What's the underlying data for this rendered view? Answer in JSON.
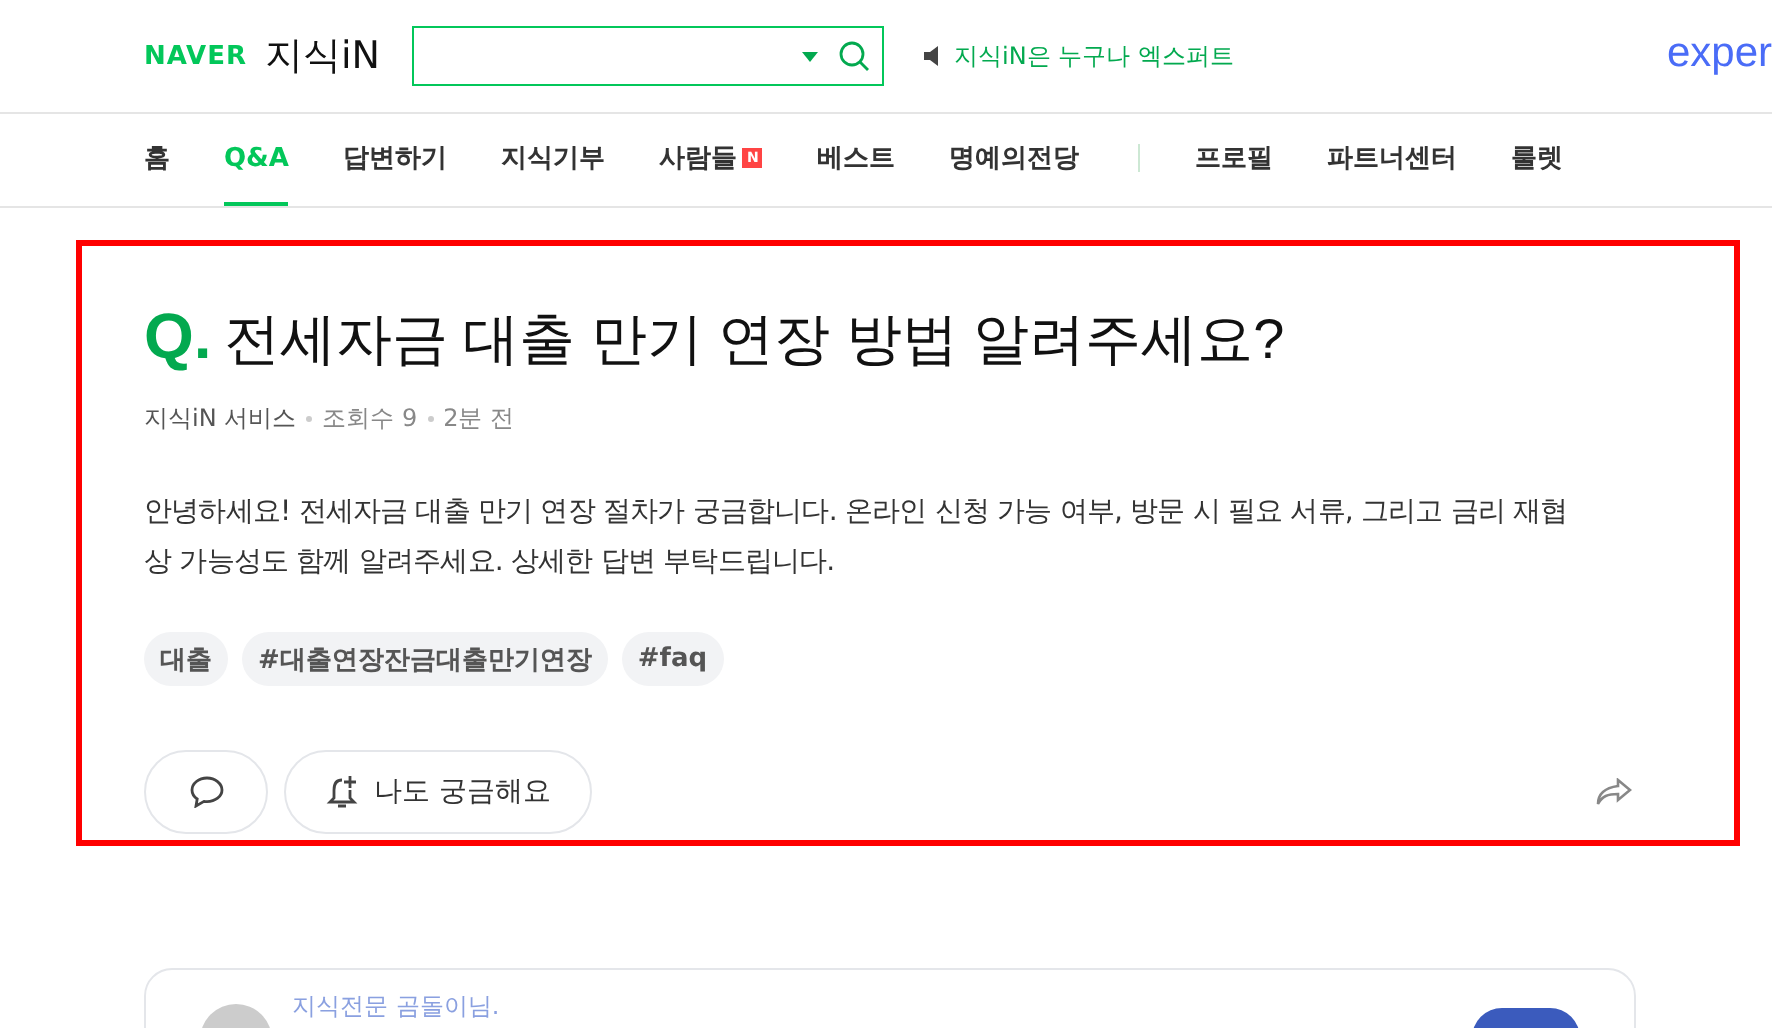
{
  "header": {
    "logo": "NAVER",
    "service": "지식iN",
    "notice": "지식iN은 누구나 엑스퍼트",
    "expert_logo": "exper"
  },
  "nav": [
    {
      "label": "홈",
      "selected": false,
      "new": false
    },
    {
      "label": "Q&A",
      "selected": true,
      "new": false
    },
    {
      "label": "답변하기",
      "selected": false,
      "new": false
    },
    {
      "label": "지식기부",
      "selected": false,
      "new": false
    },
    {
      "label": "사람들",
      "selected": false,
      "new": true,
      "badge": "N"
    },
    {
      "label": "베스트",
      "selected": false,
      "new": false
    },
    {
      "label": "명예의전당",
      "selected": false,
      "new": false,
      "divider_after": true
    },
    {
      "label": "프로필",
      "selected": false,
      "new": false
    },
    {
      "label": "파트너센터",
      "selected": false,
      "new": false
    },
    {
      "label": "룰렛",
      "selected": false,
      "new": false
    }
  ],
  "question": {
    "mark": "Q.",
    "title": "전세자금 대출 만기 연장 방법 알려주세요?",
    "meta": [
      "지식iN 서비스",
      "조회수 9",
      "2분 전"
    ],
    "body": "안녕하세요! 전세자금 대출 만기 연장 절차가 궁금합니다. 온라인 신청 가능 여부, 방문 시 필요 서류, 그리고 금리 재협상 가능성도 함께 알려주세요. 상세한 답변 부탁드립니다.",
    "tags": [
      "대출",
      "#대출연장잔금대출만기연장",
      "#faq"
    ],
    "curious_button": "나도 궁금해요"
  },
  "answer": {
    "author": "지식전문 곰돌이님."
  }
}
